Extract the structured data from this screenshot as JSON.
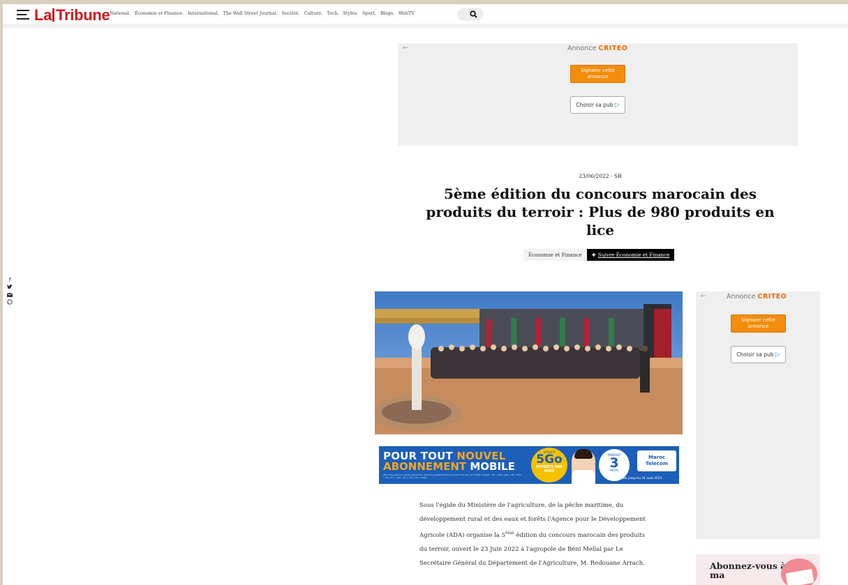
{
  "header": {
    "logo_left": "La",
    "logo_right": "Tribune",
    "nav": [
      "National.",
      "Économie et Finance.",
      "International.",
      "The Wall Street Journal.",
      "Société.",
      "Culture.",
      "Tech.",
      "Styles.",
      "Sport.",
      "Blogs.",
      "WebTV."
    ]
  },
  "ads": {
    "top": {
      "prefix": "Annonce",
      "brand": "CRITEO",
      "report": "Signaler cette annonce",
      "choose": "Choisir sa pub"
    },
    "side": {
      "prefix": "Annonce",
      "brand": "CRITEO",
      "report": "Signaler cette annonce",
      "choose": "Choisir sa pub"
    }
  },
  "article": {
    "meta": "23/06/2022 - SB",
    "title": "5ème édition du concours marocain des produits du terroir : Plus de 980 produits en lice",
    "category": "Économie et Finance",
    "follow": "Suivre Économie et Finance",
    "body_1": "Sous l'égide du Ministère de l'agriculture, de la pêche maritime, du développement rural et des eaux et forêts l'Agence pour le Développement Agricole (ADA) organise la 5",
    "body_sup": "ème",
    "body_2": " édition du concours marocain des produits du terroir, ouvert le 23 Juin 2022 à l'agropole de Béni Mellal par Le Secrétaire Général du Département de l'Agriculture, M. Redouane Arrach."
  },
  "banner": {
    "line1_a": "POUR TOUT ",
    "line1_b": "NOUVEL",
    "line2_a": "ABONNEMENT",
    "line2_b": " MOBILE",
    "fine": "Offre réservée aux clients particuliers. Volume supplémentaire de l'avant 5Go sur les forfaits suivants : 1H + 2Go / 1Go+ 4H / 15Go + 5H / 1H + 1Go / 2H + 1Go / 3H + 30Go",
    "badge5_top": "JUSQU'À",
    "badge5_big": "5Go",
    "badge5_sub": "OFFERTS PAR MOIS",
    "badge3_top": "PENDANT",
    "badge3_big": "3",
    "badge3_sub": "MOIS",
    "brand": "Maroc Telecom",
    "valid": "Valable jusqu'au 31 août 2023"
  },
  "promo": {
    "text": "Abonnez-vous à LNT ma"
  },
  "social": {
    "icons": [
      "facebook-icon",
      "twitter-icon",
      "mail-icon",
      "whatsapp-icon"
    ]
  },
  "colors": {
    "brand_red": "#d0191e",
    "criteo_orange": "#f26a00",
    "report_button": "#f38d0c",
    "banner_blue": "#1b5fb8"
  }
}
